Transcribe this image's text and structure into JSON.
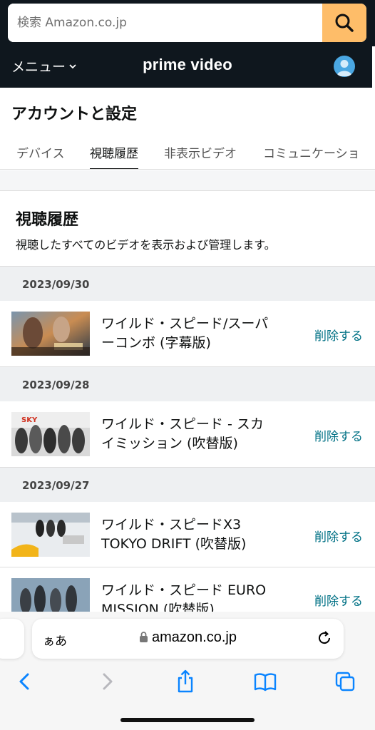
{
  "search": {
    "placeholder": "検索 Amazon.co.jp"
  },
  "nav": {
    "menu_label": "メニュー",
    "logo_text": "prime video"
  },
  "account": {
    "title": "アカウントと設定",
    "tabs": [
      {
        "label": "デバイス",
        "active": false
      },
      {
        "label": "視聴履歴",
        "active": true
      },
      {
        "label": "非表示ビデオ",
        "active": false
      },
      {
        "label": "コミュニケーショ",
        "active": false
      }
    ]
  },
  "history": {
    "title": "視聴履歴",
    "description": "視聴したすべてのビデオを表示および管理します。",
    "groups": [
      {
        "date": "2023/09/30",
        "items": [
          {
            "title": "ワイルド・スピード/スーパーコンボ (字幕版)",
            "line1": "ワイルド・スピード/スーパ",
            "line2": "ーコンボ (字幕版)",
            "action": "削除する"
          }
        ]
      },
      {
        "date": "2023/09/28",
        "items": [
          {
            "title": "ワイルド・スピード - スカイミッション (吹替版)",
            "line1": "ワイルド・スピード - スカ",
            "line2": "イミッション (吹替版)",
            "action": "削除する"
          }
        ]
      },
      {
        "date": "2023/09/27",
        "items": [
          {
            "title": "ワイルド・スピードX3 TOKYO DRIFT (吹替版)",
            "line1": "ワイルド・スピードX3",
            "line2": "TOKYO DRIFT (吹替版)",
            "action": "削除する"
          },
          {
            "title": "ワイルド・スピード EURO MISSION (吹替版)",
            "line1": "ワイルド・スピード EURO",
            "line2": "MISSION (吹替版)",
            "action": "削除する"
          }
        ]
      }
    ]
  },
  "safari": {
    "aa_label": "ぁあ",
    "url": "amazon.co.jp"
  },
  "colors": {
    "header_bg": "#0f171e",
    "search_button": "#febd69",
    "link": "#007185",
    "ios_blue": "#0a84ff"
  },
  "icons": [
    "search-icon",
    "chevron-down-icon",
    "avatar-icon",
    "lock-icon",
    "reload-icon",
    "back-icon",
    "forward-icon",
    "share-icon",
    "bookmarks-icon",
    "tabs-icon"
  ]
}
